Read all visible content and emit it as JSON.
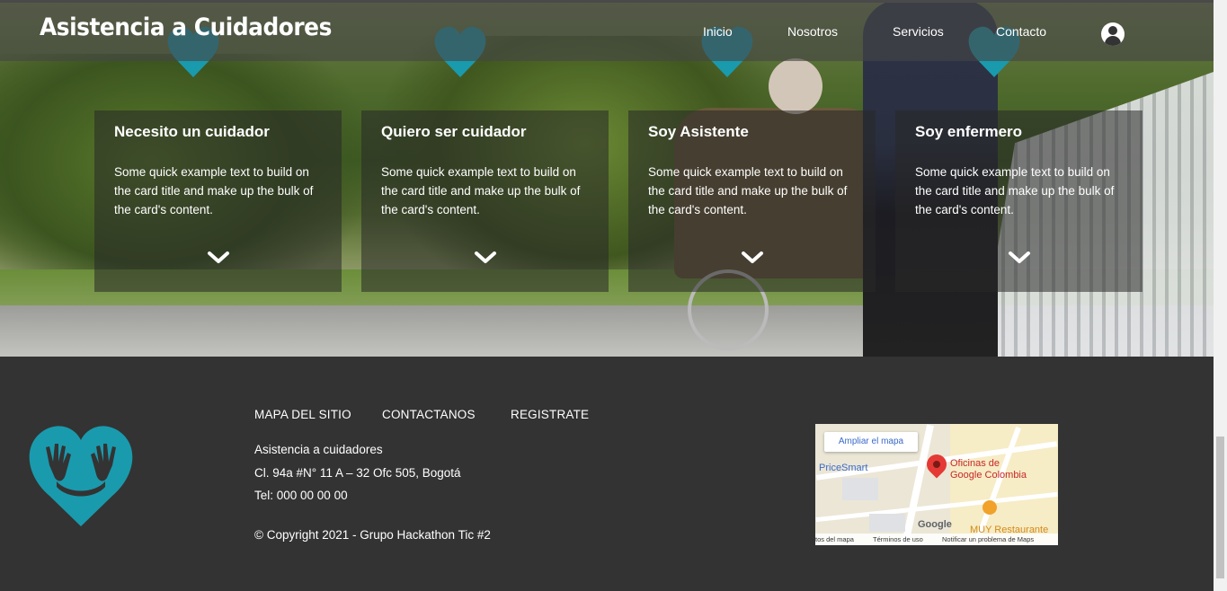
{
  "brand": "Asistencia a Cuidadores",
  "nav": {
    "links": [
      "Inicio",
      "Nosotros",
      "Servicios",
      "Contacto"
    ],
    "user_icon": "user-circle-icon"
  },
  "cards": [
    {
      "title": "Necesito un cuidador",
      "text": "Some quick example text to build on the card title and make up the bulk of the card's content."
    },
    {
      "title": "Quiero ser cuidador",
      "text": "Some quick example text to build on the card title and make up the bulk of the card's content."
    },
    {
      "title": "Soy Asistente",
      "text": "Some quick example text to build on the card title and make up the bulk of the card's content."
    },
    {
      "title": "Soy enfermero",
      "text": "Some quick example text to build on the card title and make up the bulk of the card's content."
    }
  ],
  "footer": {
    "links": [
      "MAPA DEL SITIO",
      "CONTACTANOS",
      "REGISTRATE"
    ],
    "org": "Asistencia a cuidadores",
    "address": "Cl. 94a #N° 11 A – 32 Ofc 505, Bogotá",
    "phone": "Tel: 000 00 00 00",
    "copyright": "© Copyright 2021 - Grupo Hackathon Tic #2"
  },
  "map": {
    "expand_button": "Ampliar el mapa",
    "place": "Oficinas de Google Colombia",
    "place_line1": "Oficinas de",
    "place_line2": "Google Colombia",
    "poi_left": "PriceSmart",
    "poi_right": "MUY Restaurante",
    "google": "Google",
    "footer_left": "tos del mapa",
    "footer_terms": "Términos de uso",
    "footer_report": "Notificar un problema de Maps"
  },
  "colors": {
    "accent": "#1a9aad",
    "footer_bg": "#333333",
    "pin": "#e53935"
  }
}
